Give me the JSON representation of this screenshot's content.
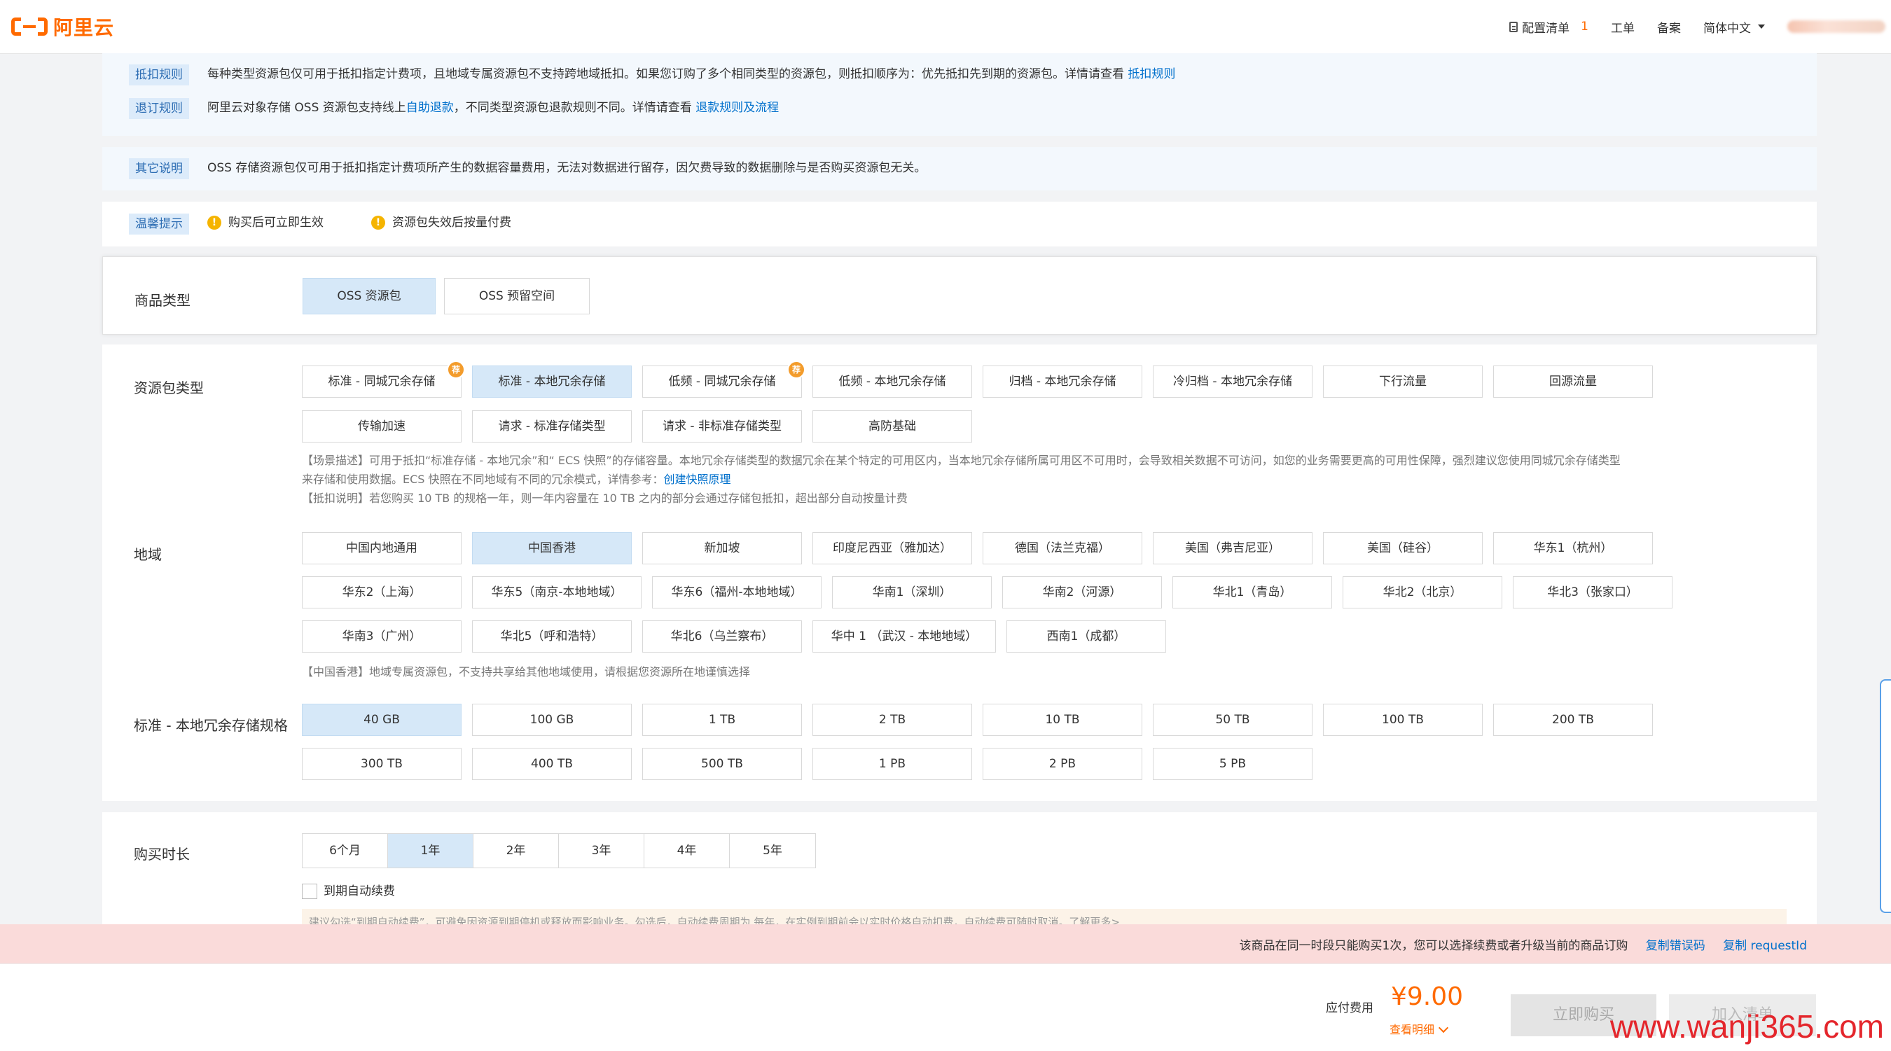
{
  "header": {
    "logo_text": "阿里云",
    "cart_label": "配置清单",
    "cart_count": "1",
    "ticket_label": "工单",
    "record_label": "备案",
    "lang_label": "简体中文"
  },
  "rules": {
    "deduct": {
      "tag": "抵扣规则",
      "text": "每种类型资源包仅可用于抵扣指定计费项，且地域专属资源包不支持跨地域抵扣。如果您订购了多个相同类型的资源包，则抵扣顺序为：优先抵扣先到期的资源包。详情请查看",
      "link": "抵扣规则"
    },
    "refund": {
      "tag": "退订规则",
      "text_a": "阿里云对象存储 OSS 资源包支持线上",
      "link_a": "自助退款",
      "text_b": "，不同类型资源包退款规则不同。详情请查看",
      "link_b": "退款规则及流程"
    },
    "other": {
      "tag": "其它说明",
      "text": "OSS 存储资源包仅可用于抵扣指定计费项所产生的数据容量费用，无法对数据进行留存，因欠费导致的数据删除与是否购买资源包无关。"
    },
    "tips": {
      "tag": "温馨提示",
      "item1": "购买后可立即生效",
      "item2": "资源包失效后按量付费"
    }
  },
  "product_type": {
    "label": "商品类型",
    "options": [
      "OSS 资源包",
      "OSS 预留空间"
    ],
    "selected_index": 0
  },
  "package_type": {
    "label": "资源包类型",
    "options": [
      "标准 - 同城冗余存储",
      "标准 - 本地冗余存储",
      "低频 - 同城冗余存储",
      "低频 - 本地冗余存储",
      "归档 - 本地冗余存储",
      "冷归档 - 本地冗余存储",
      "下行流量",
      "回源流量",
      "传输加速",
      "请求 - 标准存储类型",
      "请求 - 非标准存储类型",
      "高防基础"
    ],
    "badge": "荐",
    "note_line1": "【场景描述】可用于抵扣“标准存储 - 本地冗余”和“ ECS 快照”的存储容量。本地冗余存储类型的数据冗余在某个特定的可用区内，当本地冗余存储所属可用区不可用时，会导致相关数据不可访问，如您的业务需要更高的可用性保障，强烈建议您使用同城冗余存储类型",
    "note_line2": "来存储和使用数据。ECS 快照在不同地域有不同的冗余模式，详情参考：",
    "note_link": "创建快照原理",
    "note_line3": "【抵扣说明】若您购买 10 TB 的规格一年，则一年内容量在 10 TB 之内的部分会通过存储包抵扣，超出部分自动按量计费"
  },
  "region": {
    "label": "地域",
    "options": [
      "中国内地通用",
      "中国香港",
      "新加坡",
      "印度尼西亚（雅加达）",
      "德国（法兰克福）",
      "美国（弗吉尼亚）",
      "美国（硅谷）",
      "华东1（杭州）",
      "华东2（上海）",
      "华东5（南京-本地地域）",
      "华东6（福州-本地地域）",
      "华南1（深圳）",
      "华南2（河源）",
      "华北1（青岛）",
      "华北2（北京）",
      "华北3（张家口）",
      "华南3（广州）",
      "华北5（呼和浩特）",
      "华北6（乌兰察布）",
      "华中 1 （武汉 - 本地地域）",
      "西南1（成都）"
    ],
    "note": "【中国香港】地域专属资源包，不支持共享给其他地域使用，请根据您资源所在地谨慎选择"
  },
  "spec": {
    "label": "标准 - 本地冗余存储规格",
    "options": [
      "40 GB",
      "100 GB",
      "1 TB",
      "2 TB",
      "10 TB",
      "50 TB",
      "100 TB",
      "200 TB",
      "300 TB",
      "400 TB",
      "500 TB",
      "1 PB",
      "2 PB",
      "5 PB"
    ]
  },
  "duration": {
    "label": "购买时长",
    "options": [
      "6个月",
      "1年",
      "2年",
      "3年",
      "4年",
      "5年"
    ],
    "auto_renew_label": "到期自动续费",
    "hint": "建议勾选“到期自动续费”，可避免因资源到期停机或释放而影响业务。勾选后，自动续费周期为 每年，在实例到期前会以实时价格自动扣费，自动续费可随时取消。了解更多>"
  },
  "error": {
    "message": "该商品在同一时段只能购买1次，您可以选择续费或者升级当前的商品订购",
    "link1": "复制错误码",
    "link2": "复制 requestId"
  },
  "footer": {
    "fee_label": "应付费用",
    "fee_amount": "¥9.00",
    "detail_label": "查看明细",
    "buy_label": "立即购买",
    "cart_label": "加入清单",
    "watermark": "www.wanji365.com"
  },
  "colors": {
    "accent": "#ff6a00",
    "link": "#0070cc",
    "selected_bg": "#d6e8f8",
    "error_bg": "#fadbda"
  }
}
